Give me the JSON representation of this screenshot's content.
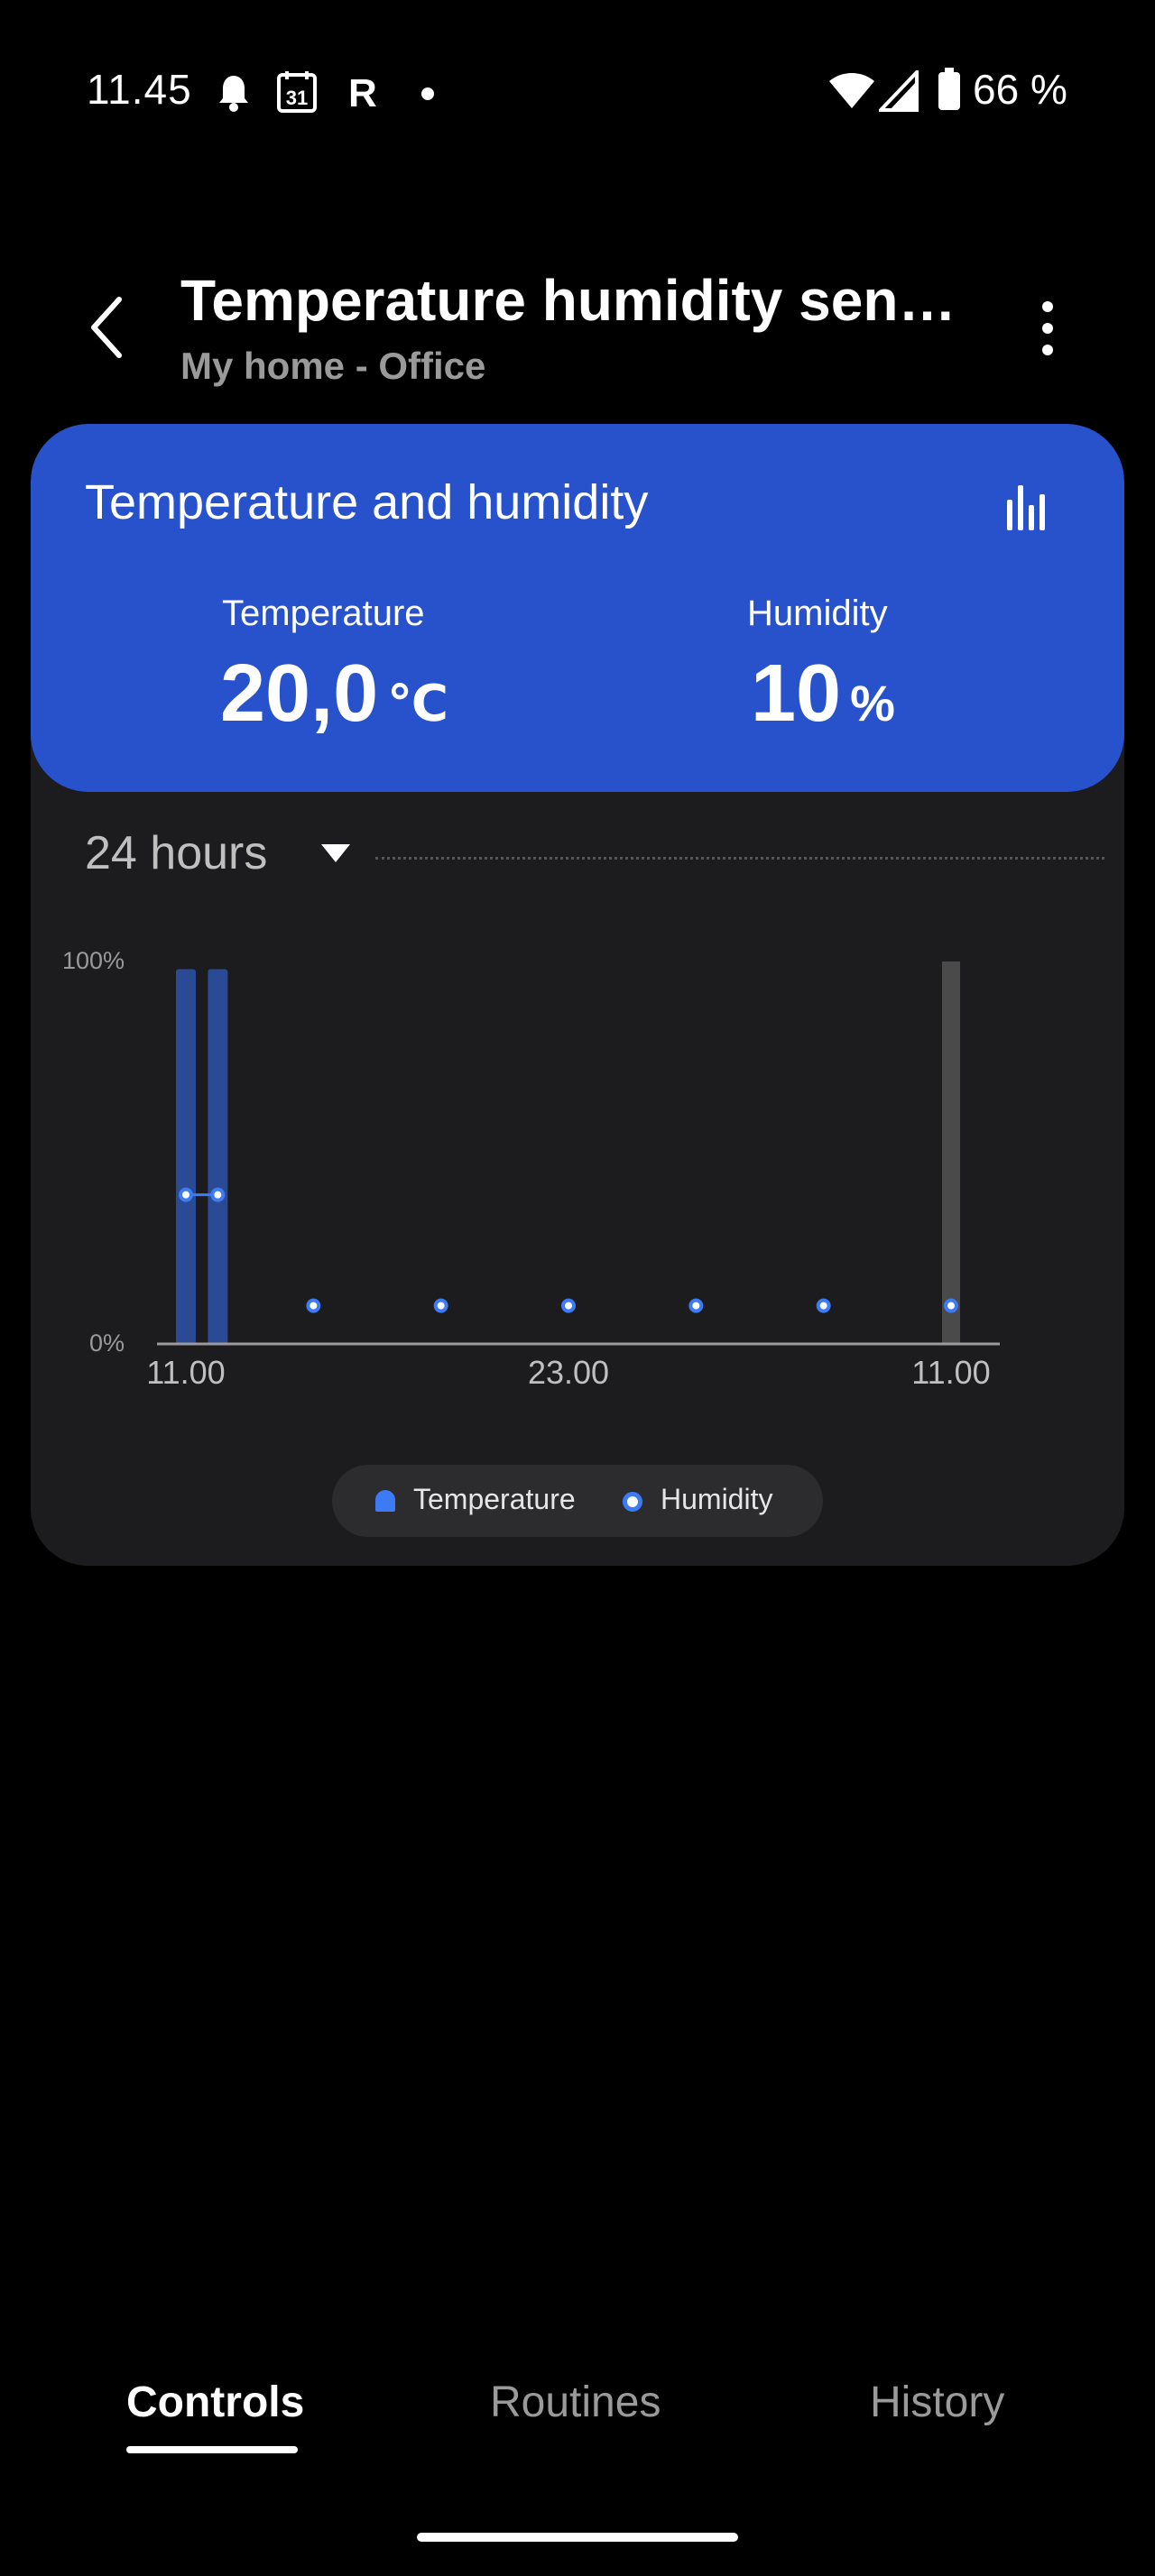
{
  "status_bar": {
    "time": "11.45",
    "battery": "66 %",
    "icons": [
      "bell-icon",
      "calendar-31-icon",
      "r-app-icon",
      "dot-icon",
      "wifi-icon",
      "signal-icon",
      "battery-icon"
    ],
    "calendar_day": "31",
    "r_glyph": "R"
  },
  "header": {
    "title": "Temperature humidity sens…",
    "subtitle": "My home - Office"
  },
  "card": {
    "title": "Temperature and humidity",
    "temperature": {
      "label": "Temperature",
      "value": "20,0",
      "unit": "℃"
    },
    "humidity": {
      "label": "Humidity",
      "value": "10",
      "unit": "%"
    },
    "range_label": "24 hours",
    "accent_color": "#2851cc"
  },
  "chart_data": {
    "type": "bar",
    "y_ticks": [
      "100%",
      "0%"
    ],
    "ylim": [
      0,
      100
    ],
    "x_ticks": [
      "11.00",
      "23.00",
      "11.00"
    ],
    "x_tick_index": [
      0,
      12,
      24
    ],
    "x_count": 25,
    "series": [
      {
        "name": "Temperature",
        "type": "bar",
        "color": "#2a4a96",
        "points": [
          {
            "x": 0,
            "y": 98
          },
          {
            "x": 1,
            "y": 98
          }
        ]
      },
      {
        "name": "Humidity",
        "type": "scatter",
        "color": "#3d7bf5",
        "points": [
          {
            "x": 0,
            "y": 39
          },
          {
            "x": 1,
            "y": 39
          },
          {
            "x": 4,
            "y": 10
          },
          {
            "x": 8,
            "y": 10
          },
          {
            "x": 12,
            "y": 10
          },
          {
            "x": 16,
            "y": 10
          },
          {
            "x": 20,
            "y": 10
          },
          {
            "x": 24,
            "y": 10
          }
        ]
      }
    ],
    "current_marker": {
      "x": 24,
      "y": 100,
      "color": "#4a4a4a"
    },
    "legend": [
      "Temperature",
      "Humidity"
    ]
  },
  "tabs": [
    {
      "label": "Controls",
      "active": true
    },
    {
      "label": "Routines",
      "active": false
    },
    {
      "label": "History",
      "active": false
    }
  ]
}
